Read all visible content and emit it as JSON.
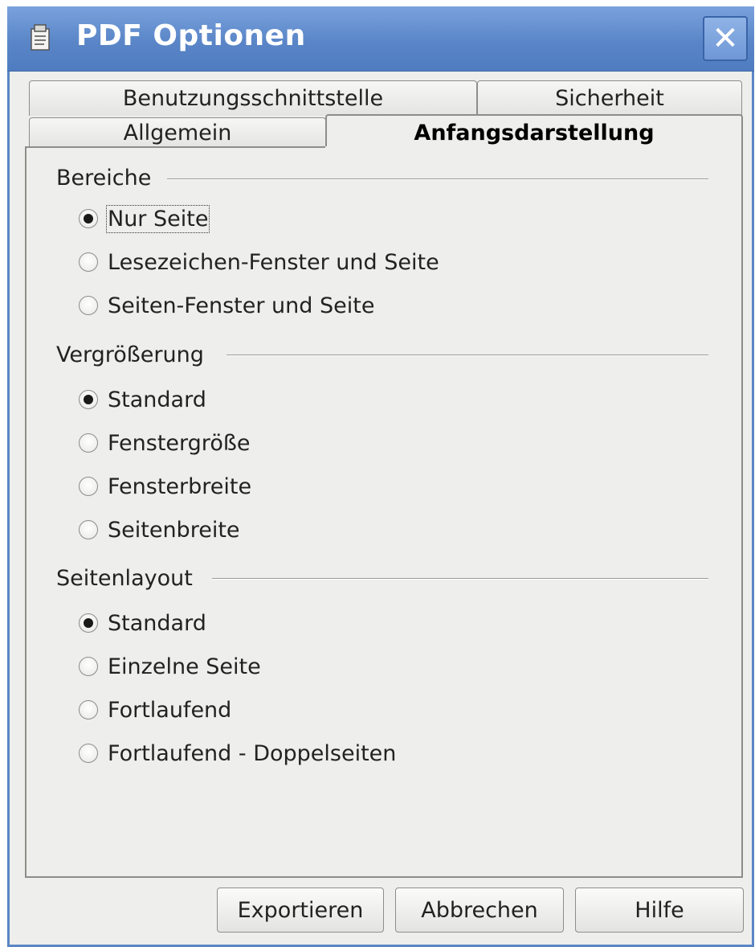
{
  "window": {
    "title": "PDF Optionen",
    "close_symbol": "✕",
    "accent_color": "#5a86c4"
  },
  "tabs": {
    "row_back": [
      {
        "label": "Benutzungsschnittstelle",
        "active": false
      },
      {
        "label": "Sicherheit",
        "active": false
      }
    ],
    "row_front": [
      {
        "label": "Allgemein",
        "active": false
      },
      {
        "label": "Anfangsdarstellung",
        "active": true
      }
    ]
  },
  "groups": {
    "bereiche": {
      "label": "Bereiche",
      "options": [
        {
          "label": "Nur Seite",
          "mnemonic": "N",
          "checked": true,
          "focused": true
        },
        {
          "label": "Lesezeichen-Fenster und Seite",
          "mnemonic": "L",
          "checked": false
        },
        {
          "label": "Seiten-Fenster und Seite",
          "mnemonic": "S",
          "checked": false
        }
      ]
    },
    "vergroesserung": {
      "label": "Vergrößerung",
      "options": [
        {
          "label": "Standard",
          "mnemonic": "a",
          "checked": true
        },
        {
          "label": "Fenstergröße",
          "mnemonic": "F",
          "checked": false
        },
        {
          "label": "Fensterbreite",
          "mnemonic": "b",
          "checked": false
        },
        {
          "label": "Seitenbreite",
          "mnemonic": "i",
          "checked": false
        }
      ]
    },
    "seitenlayout": {
      "label": "Seitenlayout",
      "options": [
        {
          "label": "Standard",
          "mnemonic": "d",
          "checked": true
        },
        {
          "label": "Einzelne Seite",
          "mnemonic": "E",
          "checked": false
        },
        {
          "label": "Fortlaufend",
          "mnemonic": "o",
          "checked": false
        },
        {
          "label": "Fortlaufend - Doppelseiten",
          "mnemonic": "p",
          "checked": false
        }
      ]
    }
  },
  "buttons": {
    "export": {
      "label": "Exportieren",
      "mnemonic": "x"
    },
    "cancel": {
      "label": "Abbrechen"
    },
    "help": {
      "label": "Hilfe",
      "mnemonic": "H"
    }
  },
  "icons": {
    "app": "document-icon",
    "close": "close-icon"
  }
}
